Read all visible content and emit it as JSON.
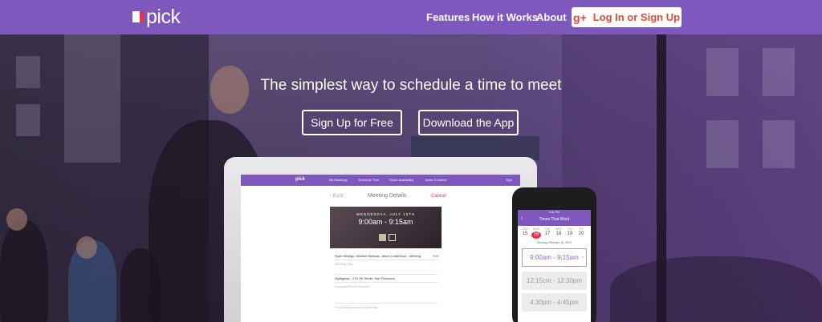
{
  "nav": {
    "logo_text": "pick",
    "links": [
      "Features",
      "How it Works",
      "About"
    ],
    "login": {
      "icon": "g+",
      "label": "Log In or Sign Up"
    }
  },
  "hero": {
    "tagline": "The simplest way to schedule a time to meet",
    "signup_label": "Sign Up for Free",
    "download_label": "Download the App"
  },
  "laptop_app": {
    "logo": "pick",
    "nav": [
      "My Meetings",
      "Schedule Time",
      "Share Availability",
      "Invite Contacts",
      "Sign"
    ],
    "back": "‹ Back",
    "title": "Meeting Details",
    "cancel": "Cancel",
    "date": "WEDNESDAY, JULY 15TH",
    "time": "9:00am - 9:15am",
    "participants": "Ryan Mindigo, Michael Sklepac, Jason Culbertson - Meeting",
    "edit": "Edit",
    "title_placeholder": "Meeting Title",
    "location": "Sightglass - 270 7th Street, San Francisco",
    "location_placeholder": "Location/Phone Number",
    "email_placeholder": "Your Email Address (required)"
  },
  "phone_app": {
    "status": "9:41 PM",
    "title": "Times That Work",
    "back": "‹",
    "days": [
      {
        "dow": "SUN",
        "num": "15"
      },
      {
        "dow": "MON",
        "num": "16"
      },
      {
        "dow": "TUE",
        "num": "17"
      },
      {
        "dow": "WED",
        "num": "18"
      },
      {
        "dow": "THU",
        "num": "19"
      },
      {
        "dow": "FRI",
        "num": "20"
      }
    ],
    "selected_date": "Monday, February 16, 2015",
    "slots": [
      "9:00am - 9:15am",
      "12:15cm - 12:30pm",
      "4:30pm - 4:45pm"
    ]
  },
  "colors": {
    "brand": "#7f58bd",
    "accent": "#e8324a",
    "google": "#dd4b39"
  }
}
